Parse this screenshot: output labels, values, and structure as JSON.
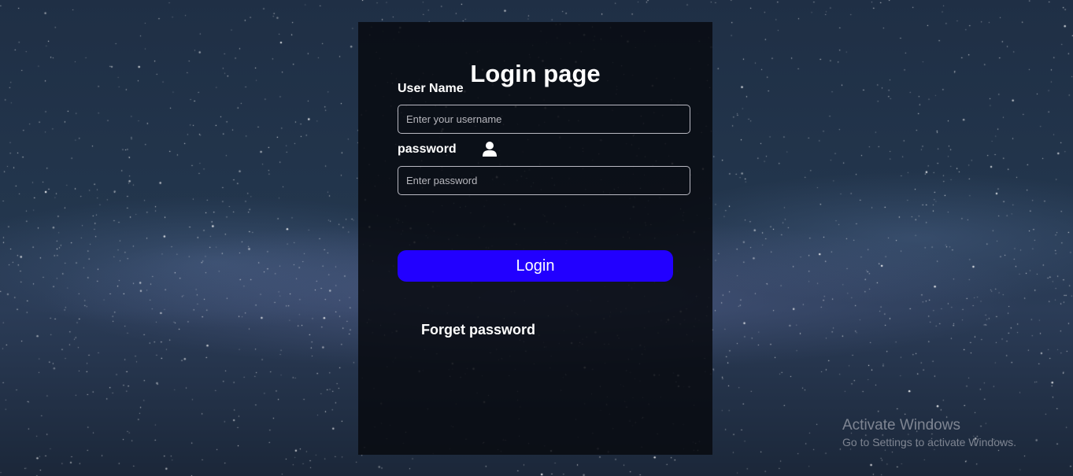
{
  "login": {
    "title": "Login page",
    "username_label": "User Name",
    "username_placeholder": "Enter your username",
    "username_value": "",
    "password_label": "password",
    "password_placeholder": "Enter password",
    "password_value": "",
    "password_label_icon": "user-icon",
    "login_button": "Login",
    "forget_link": "Forget password",
    "login_button_color": "#2200ff"
  },
  "watermark": {
    "title": "Activate Windows",
    "subtitle": "Go to Settings to activate Windows."
  }
}
